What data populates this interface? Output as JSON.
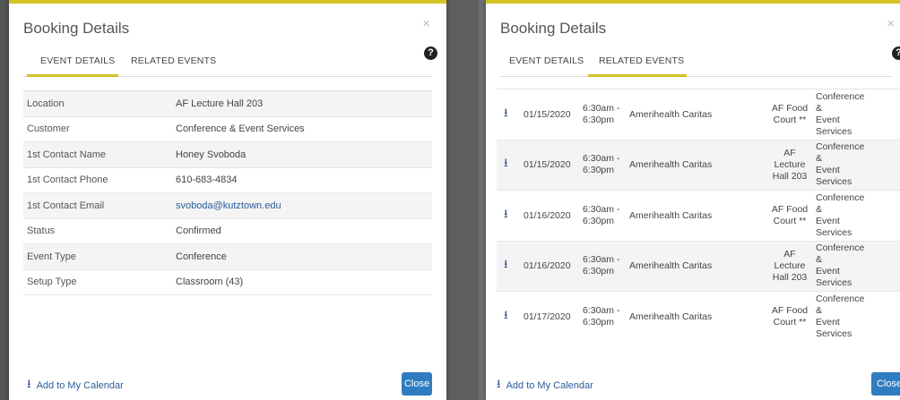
{
  "left_dialog": {
    "title": "Booking Details",
    "close_glyph": "×",
    "help_glyph": "?",
    "tabs": [
      {
        "label": "EVENT DETAILS",
        "active": true
      },
      {
        "label": "RELATED EVENTS",
        "active": false
      }
    ],
    "details": [
      {
        "label": "Location",
        "value": "AF Lecture Hall 203"
      },
      {
        "label": "Customer",
        "value": "Conference & Event Services"
      },
      {
        "label": "1st Contact Name",
        "value": "Honey Svoboda"
      },
      {
        "label": "1st Contact Phone",
        "value": "610-683-4834"
      },
      {
        "label": "1st Contact Email",
        "value": "svoboda@kutztown.edu"
      },
      {
        "label": "Status",
        "value": "Confirmed"
      },
      {
        "label": "Event Type",
        "value": "Conference"
      },
      {
        "label": "Setup Type",
        "value": "Classroom (43)"
      }
    ],
    "footer_link": "Add to My Calendar",
    "close_button": "Close"
  },
  "right_dialog": {
    "title": "Booking Details",
    "close_glyph": "×",
    "help_glyph": "?",
    "tabs": [
      {
        "label": "EVENT DETAILS",
        "active": false
      },
      {
        "label": "RELATED EVENTS",
        "active": true
      }
    ],
    "events": [
      {
        "date": "01/15/2020",
        "time": "6:30am -\n6:30pm",
        "name": "Amerihealth Caritas",
        "location": "AF Food\nCourt **",
        "organizer": "Conference &\nEvent\nServices"
      },
      {
        "date": "01/15/2020",
        "time": "6:30am -\n6:30pm",
        "name": "Amerihealth Caritas",
        "location": "AF\nLecture\nHall 203",
        "organizer": "Conference &\nEvent\nServices"
      },
      {
        "date": "01/16/2020",
        "time": "6:30am -\n6:30pm",
        "name": "Amerihealth Caritas",
        "location": "AF Food\nCourt **",
        "organizer": "Conference &\nEvent\nServices"
      },
      {
        "date": "01/16/2020",
        "time": "6:30am -\n6:30pm",
        "name": "Amerihealth Caritas",
        "location": "AF\nLecture\nHall 203",
        "organizer": "Conference &\nEvent\nServices"
      },
      {
        "date": "01/17/2020",
        "time": "6:30am -\n6:30pm",
        "name": "Amerihealth Caritas",
        "location": "AF Food\nCourt **",
        "organizer": "Conference &\nEvent\nServices"
      }
    ],
    "footer_link": "Add to My Calendar",
    "close_button": "Close"
  },
  "icons": {
    "download": "download-icon",
    "help": "help-circle-icon",
    "close": "close-icon"
  },
  "colors": {
    "accent_yellow": "#d4c228",
    "link_blue": "#2a5d9a",
    "button_blue": "#2f7cc0"
  }
}
